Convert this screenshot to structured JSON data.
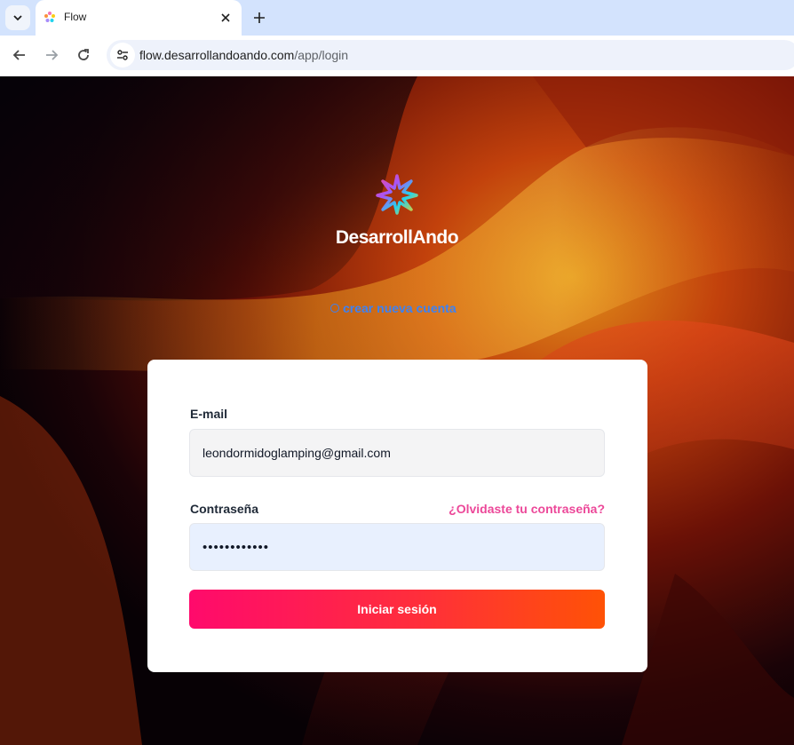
{
  "browser": {
    "tab_title": "Flow",
    "url_host": "flow.desarrollandoando.com",
    "url_path": "/app/login"
  },
  "page": {
    "brand_name": "DesarrollAndo",
    "signup_link": "crear nueva cuenta",
    "form": {
      "email_label": "E-mail",
      "email_value": "leondormidoglamping@gmail.com",
      "password_label": "Contraseña",
      "forgot_link": "¿Olvidaste tu contraseña?",
      "password_value": "••••••••••••",
      "submit_label": "Iniciar sesión"
    }
  },
  "colors": {
    "link_blue": "#3b82f6",
    "forgot_pink": "#ec4899",
    "button_start": "#ff0a6c",
    "button_end": "#ff5206"
  }
}
